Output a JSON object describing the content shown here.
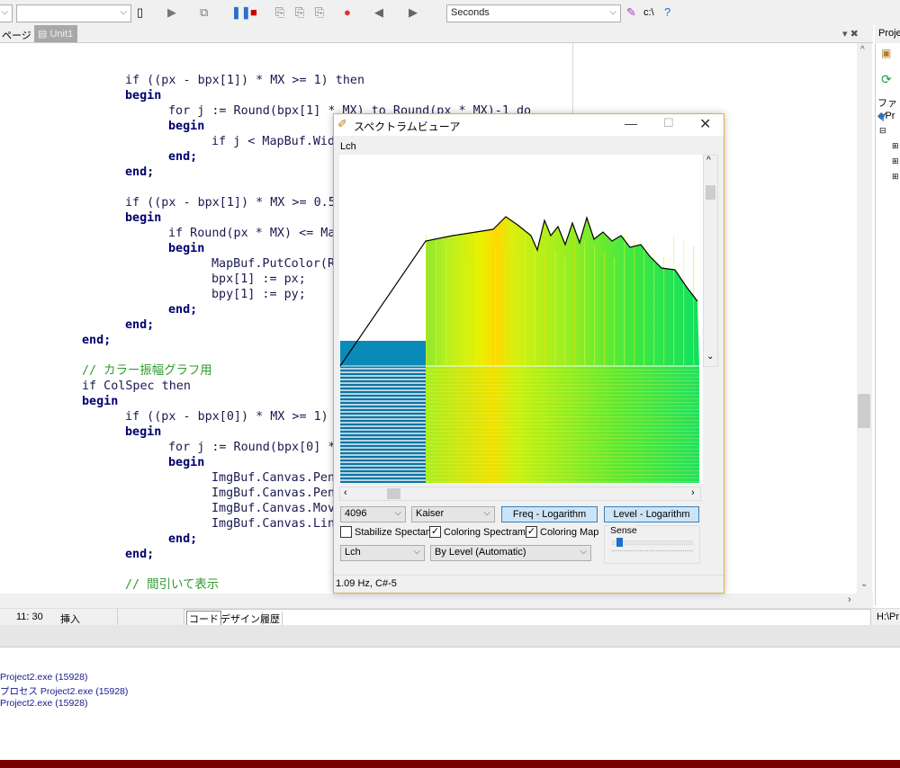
{
  "toolbar": {
    "config_combo": "",
    "target_combo": "",
    "search_combo": "Seconds",
    "path_label": "c:\\"
  },
  "tabs": {
    "pages_label": "ページ",
    "unit_tab": "Unit1",
    "project_tab": "Proje"
  },
  "editor": {
    "lines": [
      {
        "y": 0,
        "l": 1,
        "t": "if ((px - bpx[1]) * MX >= 1) then"
      },
      {
        "l": 1,
        "t": "begin"
      },
      {
        "l": 2,
        "t": "for j := Round(bpx[1] * MX) to Round(px * MX)-1 do"
      },
      {
        "l": 2,
        "t": "begin"
      },
      {
        "l": 3,
        "t": "if j < MapBuf.Wid"
      },
      {
        "l": 2,
        "t": "end;"
      },
      {
        "l": 1,
        "t": "end;"
      },
      {
        "l": 0,
        "t": ""
      },
      {
        "l": 1,
        "t": "if ((px - bpx[1]) * MX >= 0.5"
      },
      {
        "l": 1,
        "t": "begin"
      },
      {
        "l": 2,
        "t": "if Round(px * MX) <= Ma"
      },
      {
        "l": 2,
        "t": "begin"
      },
      {
        "l": 3,
        "t": "MapBuf.PutColor(R"
      },
      {
        "l": 3,
        "t": "bpx[1] := px;"
      },
      {
        "l": 3,
        "t": "bpy[1] := py;"
      },
      {
        "l": 2,
        "t": "end;"
      },
      {
        "l": 1,
        "t": "end;"
      },
      {
        "l": 0,
        "t": "end;"
      },
      {
        "l": 0,
        "t": ""
      },
      {
        "l": 0,
        "t": "// カラー振幅グラフ用"
      },
      {
        "l": 0,
        "t": "if ColSpec then"
      },
      {
        "l": 0,
        "t": "begin"
      },
      {
        "l": 1,
        "t": "if ((px - bpx[0]) * MX >= 1)"
      },
      {
        "l": 1,
        "t": "begin"
      },
      {
        "l": 2,
        "t": "for j := Round(bpx[0] *"
      },
      {
        "l": 2,
        "t": "begin"
      },
      {
        "l": 3,
        "t": "ImgBuf.Canvas.Pen"
      },
      {
        "l": 3,
        "t": "ImgBuf.Canvas.Pen"
      },
      {
        "l": 3,
        "t": "ImgBuf.Canvas.Mov"
      },
      {
        "l": 3,
        "t": "ImgBuf.Canvas.Lin"
      },
      {
        "l": 2,
        "t": "end;"
      },
      {
        "l": 1,
        "t": "end;"
      },
      {
        "l": 0,
        "t": ""
      },
      {
        "l": 1,
        "t": "// 間引いて表示"
      }
    ]
  },
  "right_panel": {
    "file_label": "ファイ",
    "project_item": "Pr"
  },
  "status": {
    "position": "11: 30",
    "mode": "挿入",
    "tabs": [
      "コード",
      "デザイン",
      "履歴"
    ],
    "path": "H:\\Pr"
  },
  "messages": [
    "Project2.exe (15928)",
    "プロセス Project2.exe (15928)",
    " Project2.exe (15928)"
  ],
  "spectrum_viewer": {
    "title": "スペクトラムビューア",
    "menu": "Lch",
    "fft_size": "4096",
    "window_fn": "Kaiser",
    "freq_button": "Freq - Logarithm",
    "level_button": "Level - Logarithm",
    "stabilize": {
      "label": "Stabilize Spectam",
      "checked": false
    },
    "coloring_spectrum": {
      "label": "Coloring Spectram",
      "checked": true
    },
    "coloring_map": {
      "label": "Coloring Map",
      "checked": true
    },
    "channel": "Lch",
    "color_mode": "By Level (Automatic)",
    "sense_label": "Sense",
    "sense_value": 0.05,
    "status": "1.09 Hz, C#-5"
  },
  "colors": {
    "accent_border": "#e0b040",
    "bottom_bar": "#780000",
    "button": "#cce4f7"
  }
}
